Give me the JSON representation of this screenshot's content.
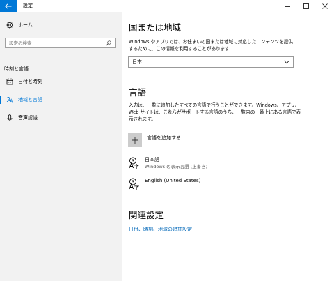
{
  "window": {
    "title": "設定"
  },
  "sidebar": {
    "home_label": "ホーム",
    "search_placeholder": "設定の検索",
    "section_title": "時刻と言語",
    "items": [
      {
        "label": "日付と時刻",
        "icon": "calendar-icon",
        "active": false
      },
      {
        "label": "地域と言語",
        "icon": "language-icon",
        "active": true
      },
      {
        "label": "音声認識",
        "icon": "microphone-icon",
        "active": false
      }
    ]
  },
  "main": {
    "region": {
      "heading": "国または地域",
      "description": "Windows やアプリでは、お住まいの国または地域に対応したコンテンツを提供するために、この情報を利用することがあります",
      "selected": "日本"
    },
    "language": {
      "heading": "言語",
      "description": "入力は、一覧に追加したすべての言語で行うことができます。Windows、アプリ、Web サイトは、これらがサポートする言語のうち、一覧内の一番上にある言語で表示されます。",
      "add_label": "言語を追加する",
      "languages": [
        {
          "name": "日本語",
          "sub": "Windows の表示言語 (上書き)"
        },
        {
          "name": "English (United States)",
          "sub": ""
        }
      ]
    },
    "related": {
      "heading": "関連設定",
      "link": "日付、時刻、地域の追加設定"
    }
  },
  "colors": {
    "accent": "#0078d7",
    "sidebar_bg": "#f2f2f2",
    "link": "#0067b8"
  }
}
